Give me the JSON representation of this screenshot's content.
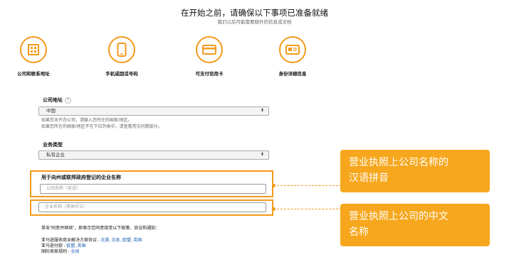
{
  "header": {
    "title": "在开始之前，请确保以下事项已准备就绪",
    "subtitle": "我们以后可能需要额外的信息或文档"
  },
  "steps": [
    {
      "icon": "building-icon",
      "label": "公司和联系地址"
    },
    {
      "icon": "phone-icon",
      "label": "手机或固话号码"
    },
    {
      "icon": "credit-card-icon",
      "label": "可支付信用卡"
    },
    {
      "icon": "id-card-icon",
      "label": "身份详细信息"
    }
  ],
  "form": {
    "address_label": "公司地址",
    "address_help": "?",
    "country_value": "中国",
    "country_hint_1": "如果您未开办公司，请输入您所在的国家/地区。",
    "country_hint_2": "如果您所在的国家/地区不在下拉列表中，请查看常见问题部分。",
    "business_type_label": "业务类型",
    "business_type_value": "私有企业",
    "company_name_label": "用于向州或联邦政府登记的企业名称",
    "company_name_en_placeholder": "公司名称（英语）",
    "company_name_cn_placeholder": "企业名称（简体中文）"
  },
  "callouts": {
    "pinyin": "营业执照上公司名称的汉语拼音",
    "pinyin_line1": "营业执照上公司名称的",
    "pinyin_line2": "汉语拼音",
    "chinese_line1": "营业执照上公司的中文",
    "chinese_line2": "名称"
  },
  "agreement": {
    "intro": "单击\"同意并继续\"，即表示您同意接受以下政策、协议和通知：",
    "line1_text": "亚马逊服务商业解决方案协议 - ",
    "line1_links": "北美, 日本, 欧盟, 英国",
    "line2_text": "亚马逊付款 - ",
    "line2_links": "欧盟, 英国",
    "line3_text": "国际卖家规则 - ",
    "line3_links": "全球"
  },
  "colors": {
    "accent": "#f39a1a",
    "callout": "#f7a71d",
    "link": "#1a5fb4"
  }
}
